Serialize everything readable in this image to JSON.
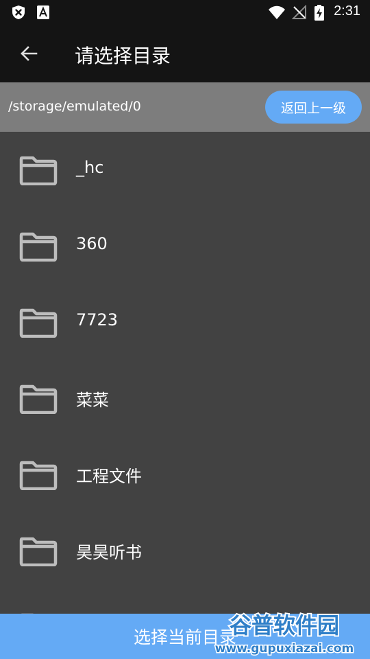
{
  "status_bar": {
    "time": "2:31",
    "icons": [
      "shield-x-icon",
      "text-a-icon",
      "wifi-icon",
      "no-signal-icon",
      "battery-charging-icon"
    ]
  },
  "app_bar": {
    "back_icon": "arrow-left-icon",
    "title": "请选择目录"
  },
  "path_bar": {
    "current_path": "/storage/emulated/0",
    "up_button_label": "返回上一级"
  },
  "folders": [
    {
      "name": "_hc",
      "icon": "folder-icon"
    },
    {
      "name": "360",
      "icon": "folder-icon"
    },
    {
      "name": "7723",
      "icon": "folder-icon"
    },
    {
      "name": "菜菜",
      "icon": "folder-icon"
    },
    {
      "name": "工程文件",
      "icon": "folder-icon"
    },
    {
      "name": "昊昊听书",
      "icon": "folder-icon"
    },
    {
      "name": "",
      "icon": "folder-icon"
    }
  ],
  "bottom_button": {
    "label": "选择当前目录"
  },
  "watermark": {
    "title": "谷普软件园",
    "url": "www.gupuxiazai.com"
  },
  "colors": {
    "top_bar": "#141414",
    "path_bar": "#7d7d7d",
    "list_background": "#424242",
    "accent_blue": "#64aaf5",
    "folder_icon": "#bdbdbd"
  }
}
